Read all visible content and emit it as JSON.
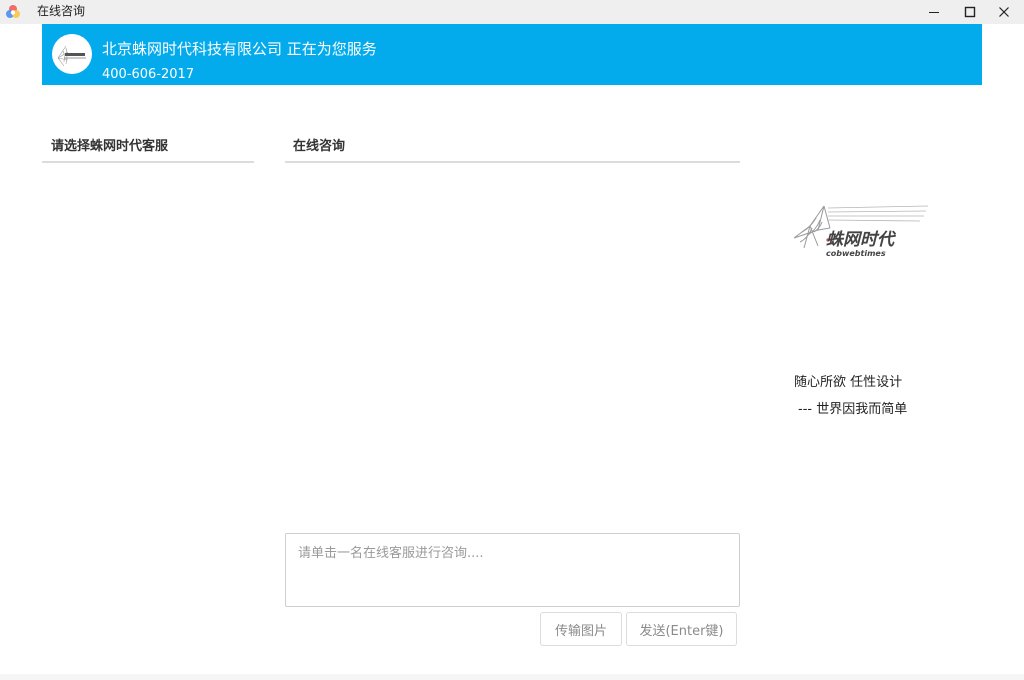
{
  "window": {
    "title": "在线咨询"
  },
  "header": {
    "company_status": "北京蛛网时代科技有限公司 正在为您服务",
    "phone": "400-606-2017",
    "logo_icon": "cobweb-logo-icon",
    "background_color": "#03abed"
  },
  "left_panel": {
    "title": "请选择蛛网时代客服"
  },
  "chat_panel": {
    "title": "在线咨询",
    "input_placeholder": "请单击一名在线客服进行咨询....",
    "upload_button": "传输图片",
    "send_button": "发送(Enter键)"
  },
  "right_panel": {
    "logo_icon": "cobweb-times-logo-icon",
    "slogan_line1": "随心所欲 任性设计",
    "slogan_line2": "--- 世界因我而简单"
  }
}
